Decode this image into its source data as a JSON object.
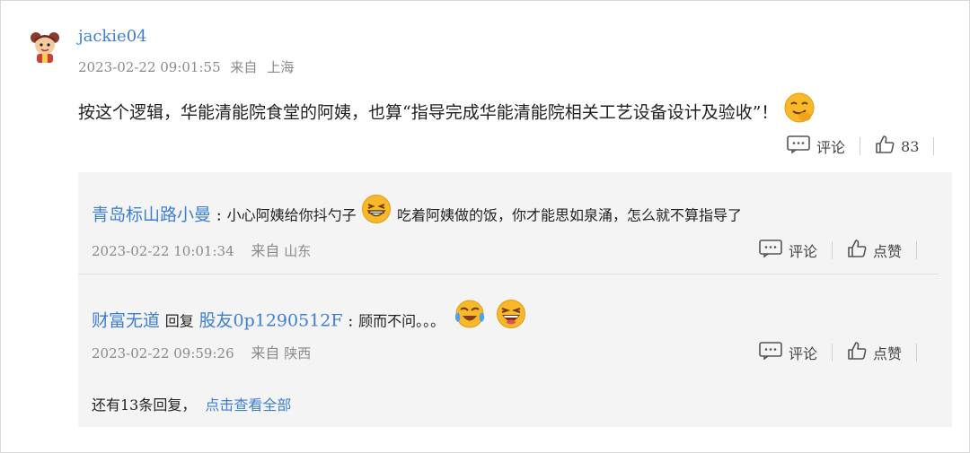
{
  "comment": {
    "username": "jackie04",
    "timestamp": "2023-02-22 09:01:55",
    "source_prefix": "来自",
    "location": "上海",
    "text": "按这个逻辑，华能清能院食堂的阿姨，也算“指导完成华能清能院相关工艺设备设计及验收”！",
    "comment_label": "评论",
    "like_count": "83"
  },
  "replies": [
    {
      "author": "青岛标山路小曼",
      "colon": ":",
      "text_before": "小心阿姨给你抖勺子",
      "text_after": "吃着阿姨做的饭，你才能思如泉涌，怎么就不算指导了",
      "timestamp": "2023-02-22 10:01:34",
      "source_prefix": "来自",
      "location": "山东",
      "comment_label": "评论",
      "like_label": "点赞"
    },
    {
      "author": "财富无道",
      "reply_word": "回复",
      "target": "股友0p1290512F",
      "colon": ":",
      "text": "顾而不问。。。",
      "timestamp": "2023-02-22 09:59:26",
      "source_prefix": "来自",
      "location": "陕西",
      "comment_label": "评论",
      "like_label": "点赞"
    }
  ],
  "more_replies": {
    "text": "还有13条回复，",
    "link": "点击查看全部"
  },
  "icons": {
    "avatar": "cartoon-character-avatar",
    "emoji_1": "smirk-emoji",
    "emoji_2": "grin-emoji",
    "emoji_3": "crying-laughing-emoji",
    "emoji_4": "big-laugh-emoji",
    "comment": "comment-icon",
    "like": "thumbs-up-icon"
  },
  "colors": {
    "link": "#3d7fd3",
    "meta": "#8a8a8a",
    "reply_bg": "#f4f4f4",
    "emoji": "#f7b928"
  }
}
